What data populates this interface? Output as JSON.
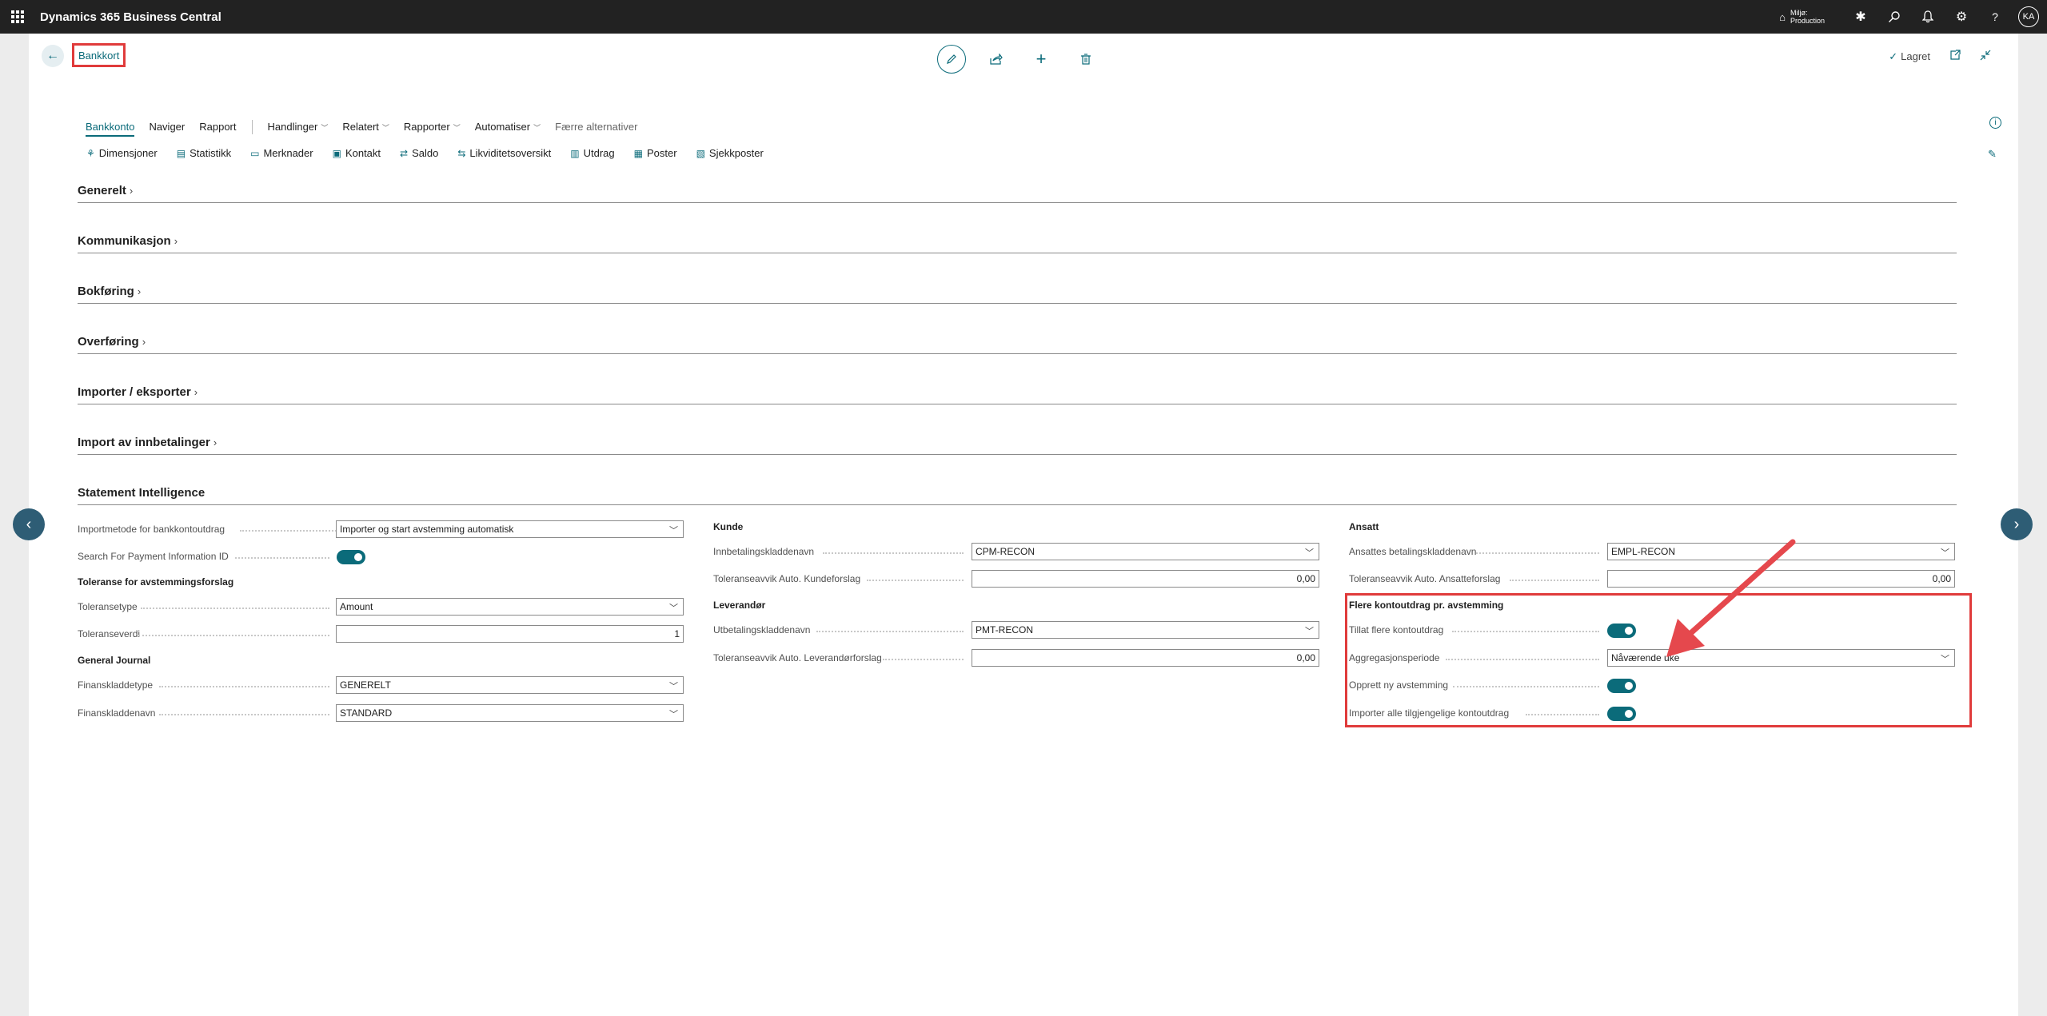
{
  "topbar": {
    "app_title": "Dynamics 365 Business Central",
    "env_line1": "Miljø:",
    "env_line2": "Production",
    "avatar_initials": "KA"
  },
  "header": {
    "breadcrumb": "Bankkort",
    "saved_label": "Lagret"
  },
  "tabs": {
    "bankkonto": "Bankkonto",
    "naviger": "Naviger",
    "rapport": "Rapport",
    "handlinger": "Handlinger",
    "relatert": "Relatert",
    "rapporter": "Rapporter",
    "automatiser": "Automatiser",
    "faerre": "Færre alternativer"
  },
  "promoted": {
    "dimensjoner": "Dimensjoner",
    "statistikk": "Statistikk",
    "merknader": "Merknader",
    "kontakt": "Kontakt",
    "saldo": "Saldo",
    "likviditet": "Likviditetsoversikt",
    "utdrag": "Utdrag",
    "poster": "Poster",
    "sjekkposter": "Sjekkposter"
  },
  "fasttabs": {
    "generelt": "Generelt",
    "kommunikasjon": "Kommunikasjon",
    "bokforing": "Bokføring",
    "overforing": "Overføring",
    "importer_eksporter": "Importer / eksporter",
    "import_innbetalinger": "Import av innbetalinger",
    "statement_intelligence": "Statement Intelligence"
  },
  "col1": {
    "importmetode_label": "Importmetode for bankkontoutdrag",
    "importmetode_value": "Importer og start avstemming automatisk",
    "search_payment_label": "Search For Payment Information ID",
    "toleranse_group": "Toleranse for avstemmingsforslag",
    "toleransetype_label": "Toleransetype",
    "toleransetype_value": "Amount",
    "toleranseverdi_label": "Toleranseverdi",
    "toleranseverdi_value": "1",
    "general_journal_group": "General Journal",
    "finanskladdetype_label": "Finanskladdetype",
    "finanskladdetype_value": "GENERELT",
    "finanskladdenavn_label": "Finanskladdenavn",
    "finanskladdenavn_value": "STANDARD"
  },
  "col2": {
    "kunde_group": "Kunde",
    "innbetaling_label": "Innbetalingskladdenavn",
    "innbetaling_value": "CPM-RECON",
    "tol_kunde_label": "Toleranseavvik Auto. Kundeforslag",
    "tol_kunde_value": "0,00",
    "leverandor_group": "Leverandør",
    "utbetaling_label": "Utbetalingskladdenavn",
    "utbetaling_value": "PMT-RECON",
    "tol_lev_label": "Toleranseavvik Auto. Leverandørforslag",
    "tol_lev_value": "0,00"
  },
  "col3": {
    "ansatt_group": "Ansatt",
    "ansattes_label": "Ansattes betalingskladdenavn",
    "ansattes_value": "EMPL-RECON",
    "tol_ansatt_label": "Toleranseavvik Auto. Ansatteforslag",
    "tol_ansatt_value": "0,00",
    "flere_group": "Flere kontoutdrag pr. avstemming",
    "tillat_label": "Tillat flere kontoutdrag",
    "aggregering_label": "Aggregasjonsperiode",
    "aggregering_value": "Nåværende uke",
    "opprett_label": "Opprett ny avstemming",
    "importer_alle_label": "Importer alle tilgjengelige kontoutdrag"
  },
  "colors": {
    "accent": "#0b6b7a",
    "highlight": "#e03b3b",
    "topbar": "#222222"
  }
}
